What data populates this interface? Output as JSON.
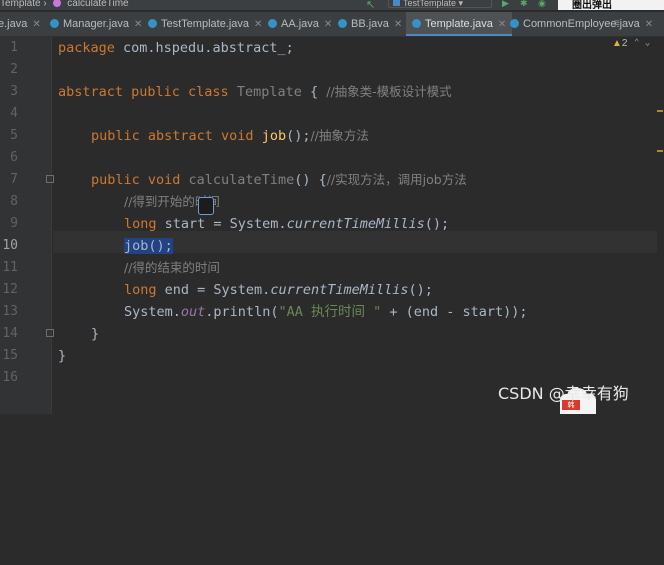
{
  "header": {
    "breadcrumb_file": "Template",
    "breadcrumb_method": "calculateTime",
    "run_config": "TestTemplate",
    "overlay_text": "圈出弹出"
  },
  "tabs": [
    {
      "label": "e.java"
    },
    {
      "label": "Manager.java"
    },
    {
      "label": "TestTemplate.java"
    },
    {
      "label": "AA.java"
    },
    {
      "label": "BB.java"
    },
    {
      "label": "Template.java",
      "active": true
    },
    {
      "label": "CommonEmployee.java"
    }
  ],
  "inspections": {
    "warnings": "2"
  },
  "editor": {
    "current_line": "10",
    "line_numbers": [
      "1",
      "2",
      "3",
      "4",
      "5",
      "6",
      "7",
      "8",
      "9",
      "10",
      "11",
      "12",
      "13",
      "14",
      "15",
      "16"
    ],
    "code": {
      "l1_kw": "package",
      "l1_rest": " com.hspedu.abstract_;",
      "l3_kw": "abstract public class",
      "l3_name": " Template",
      "l3_brace": " { ",
      "l3_comment": "//抽象类-模板设计模式",
      "l5_kw": "public abstract void",
      "l5_fn": " job",
      "l5_rest": "();",
      "l5_comment": "//抽象方法",
      "l7_kw": "public void",
      "l7_fn": " calculateTime",
      "l7_rest": "() {",
      "l7_comment": "//实现方法，调用job方法",
      "l8_comment": "//得到开始的时间",
      "l9_kw": "long",
      "l9_a": " start = System.",
      "l9_m": "currentTimeMillis",
      "l9_b": "();",
      "l10_sel": "job();",
      "l11_comment": "//得的结束的时间",
      "l12_kw": "long",
      "l12_a": " end = System.",
      "l12_m": "currentTimeMillis",
      "l12_b": "();",
      "l13_a": "System.",
      "l13_out": "out",
      "l13_b": ".println(",
      "l13_str": "\"AA 执行时间 \"",
      "l13_c": " + (end - start));",
      "l14": "}",
      "l15": "}"
    }
  },
  "watermark": "CSDN @幸幸有狗",
  "sticker_badge": "韩"
}
